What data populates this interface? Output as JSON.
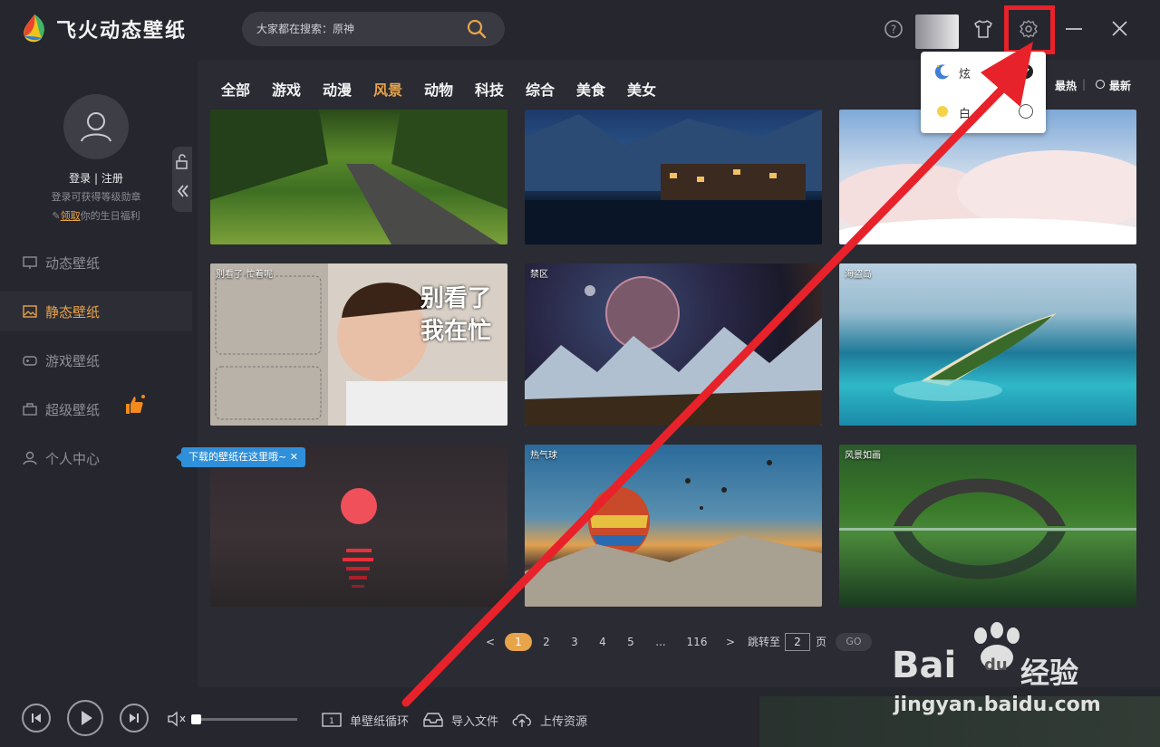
{
  "app": {
    "title": "飞火动态壁纸"
  },
  "search": {
    "placeholder": "大家都在搜索：原神"
  },
  "theme_menu": {
    "items": [
      {
        "label": "炫",
        "checked": true
      },
      {
        "label": "白",
        "checked": false
      }
    ]
  },
  "user": {
    "login": "登录",
    "separator": "|",
    "register": "注册",
    "subtitle": "登录可获得等级勋章",
    "gift_link": "领取",
    "gift_text": "你的生日福利"
  },
  "sidebar": {
    "items": [
      {
        "label": "动态壁纸",
        "icon": "monitor-icon"
      },
      {
        "label": "静态壁纸",
        "icon": "image-icon",
        "active": true
      },
      {
        "label": "游戏壁纸",
        "icon": "gamepad-icon"
      },
      {
        "label": "超级壁纸",
        "icon": "briefcase-icon"
      },
      {
        "label": "个人中心",
        "icon": "user-icon"
      }
    ],
    "tooltip": "下载的壁纸在这里哦~"
  },
  "categories": [
    "全部",
    "游戏",
    "动漫",
    "风景",
    "动物",
    "科技",
    "综合",
    "美食",
    "美女"
  ],
  "active_category": "风景",
  "sort": {
    "hot": "最热",
    "new": "最新"
  },
  "tiles": [
    {
      "caption": ""
    },
    {
      "caption": ""
    },
    {
      "caption": ""
    },
    {
      "caption": "别看了 忙着呢",
      "overlay_text_1": "别看了",
      "overlay_text_2": "我在忙"
    },
    {
      "caption": "禁区"
    },
    {
      "caption": "海盗岛"
    },
    {
      "caption": ""
    },
    {
      "caption": "热气球"
    },
    {
      "caption": "风景如画"
    }
  ],
  "pager": {
    "prev": "<",
    "pages": [
      "1",
      "2",
      "3",
      "4",
      "5",
      "...",
      "116"
    ],
    "next": ">",
    "jump_label": "跳转至",
    "jump_value": "2",
    "page_unit": "页",
    "go": "GO"
  },
  "bottom": {
    "loop": "单壁纸循环",
    "import": "导入文件",
    "upload": "上传资源"
  },
  "watermark": {
    "brand": "Bai",
    "suffix": "经验",
    "url": "jingyan.baidu.com"
  },
  "colors": {
    "accent": "#e7a44a",
    "annotation": "#e8222a",
    "tooltip": "#2f8fd9"
  }
}
